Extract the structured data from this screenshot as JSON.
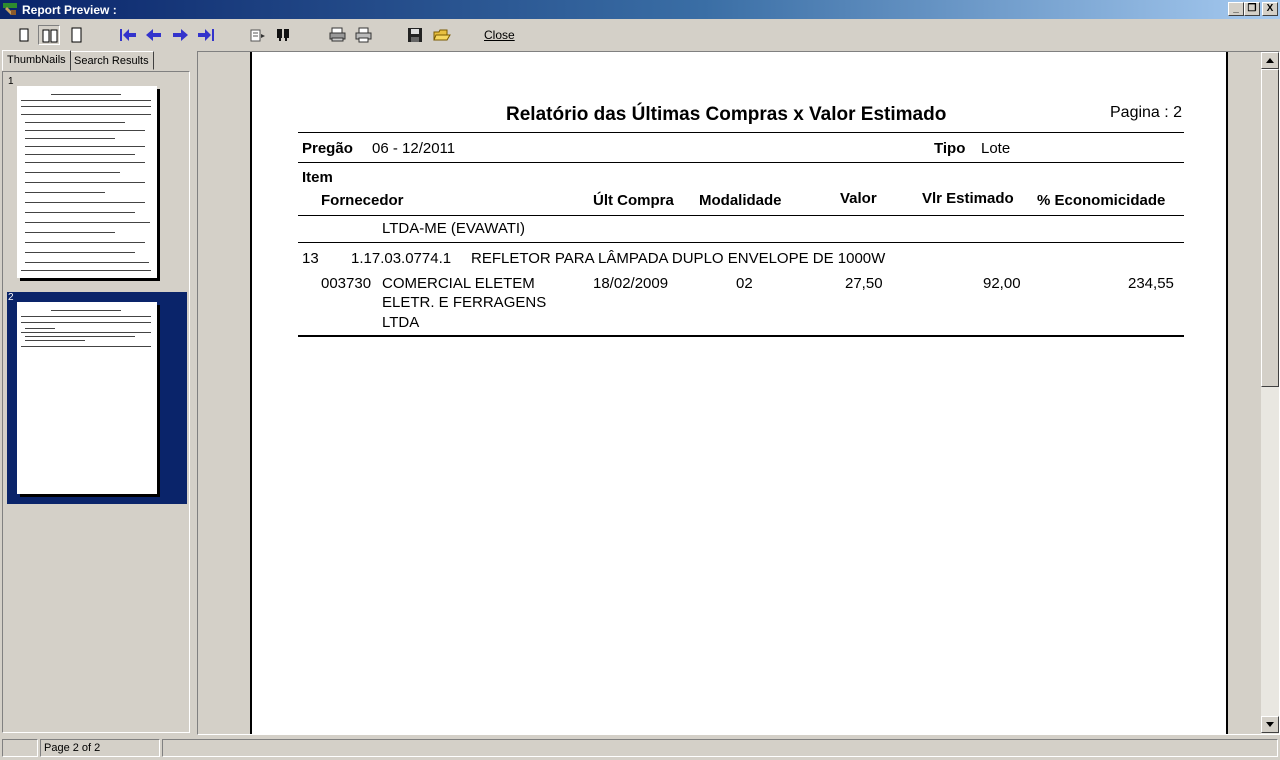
{
  "window": {
    "title": "Report Preview :",
    "buttons": {
      "minimize": "_",
      "restore": "❐",
      "close": "X"
    }
  },
  "toolbar": {
    "buttons": [
      "single-page-icon",
      "two-pages-icon",
      "page-width-icon",
      "first-page-icon",
      "prev-page-icon",
      "next-page-icon",
      "last-page-icon",
      "find-icon",
      "find-next-icon",
      "print-setup-icon",
      "print-icon",
      "save-icon",
      "open-icon"
    ],
    "close_label": "Close"
  },
  "tabs": {
    "thumbnails": "ThumbNails",
    "search": "Search Results"
  },
  "thumbnails": [
    {
      "number": "1",
      "selected": false
    },
    {
      "number": "2",
      "selected": true
    }
  ],
  "report": {
    "title": "Relatório das Últimas Compras x Valor Estimado",
    "page_label": "Pagina : 2",
    "pregao_label": "Pregão",
    "pregao_value": "06 - 12/2011",
    "tipo_label": "Tipo",
    "tipo_value": "Lote",
    "headers": {
      "item": "Item",
      "fornecedor": "Fornecedor",
      "ult_compra": "Últ Compra",
      "modalidade": "Modalidade",
      "valor": "Valor",
      "vlr_estimado": "Vlr Estimado",
      "economicidade": "% Economicidade"
    },
    "carryover_line": "LTDA-ME (EVAWATI)",
    "items": [
      {
        "item_no": "13",
        "code": "1.17.03.0774.1",
        "description": "REFLETOR PARA LÂMPADA DUPLO ENVELOPE DE 1000W",
        "supplier_code": "003730",
        "supplier_name_lines": [
          "COMERCIAL ELETEM",
          "ELETR. E FERRAGENS",
          "LTDA"
        ],
        "ult_compra": "18/02/2009",
        "modalidade": "02",
        "valor": "27,50",
        "vlr_estimado": "92,00",
        "economicidade": "234,55"
      }
    ]
  },
  "statusbar": {
    "page_info": "Page 2 of 2"
  }
}
